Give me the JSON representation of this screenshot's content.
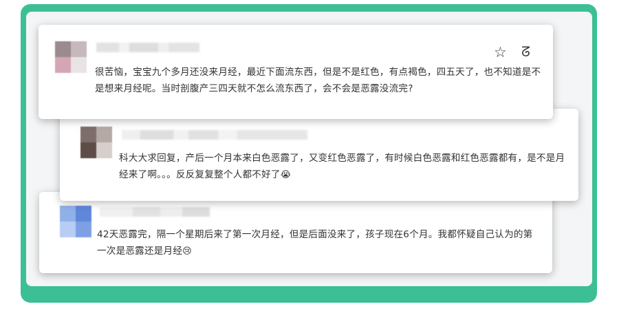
{
  "comments": [
    {
      "text": "很苦恼，宝宝九个多月还没来月经，最近下面流东西，但是不是红色，有点褐色，四五天了，也不知道是不是想来月经呢。当时剖腹产三四天就不怎么流东西了，会不会是恶露没流完?",
      "icons": [
        "star-icon",
        "share-icon"
      ],
      "avatar_colors": [
        "#9b8a8e",
        "#c6b8bb",
        "#d4a7b4",
        "#eae3e5"
      ]
    },
    {
      "text": "科大大求回复，产后一个月本来白色恶露了，又变红色恶露了，有时候白色恶露和红色恶露都有，是不是月经来了啊。。。反反复复整个人都不好了",
      "emoji": "😭",
      "avatar_colors": [
        "#7d6e6b",
        "#b4a9a4",
        "#5e4d47",
        "#d6cfcc"
      ]
    },
    {
      "text": "42天恶露完，隔一个星期后来了第一次月经，但是后面没来了，孩子现在6个月。我都怀疑自己认为的第一次是恶露还是月经",
      "emoji": "😢",
      "avatar_colors": [
        "#8fb1ea",
        "#5f87da",
        "#b8cdf3",
        "#7da0e5"
      ]
    }
  ]
}
